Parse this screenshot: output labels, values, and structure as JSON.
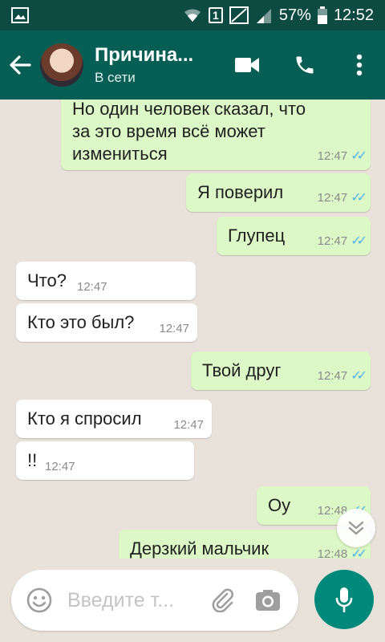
{
  "status_bar": {
    "sim_slot": "1",
    "battery": "57%",
    "time": "12:52"
  },
  "header": {
    "title": "Причина...",
    "subtitle": "В сети"
  },
  "messages": [
    {
      "type": "out",
      "text": "Но один человек сказал, что\nза это время всё может\nизмениться",
      "time": "12:47",
      "read": true
    },
    {
      "type": "out",
      "text": "Я поверил",
      "time": "12:47",
      "read": true
    },
    {
      "type": "out",
      "text": "Глупец",
      "time": "12:47",
      "read": true
    },
    {
      "type": "in",
      "text": "Что?",
      "time": "12:47"
    },
    {
      "type": "in",
      "text": "Кто это был?",
      "time": "12:47"
    },
    {
      "type": "out",
      "text": "Твой друг",
      "time": "12:47",
      "read": true
    },
    {
      "type": "in",
      "text": "Кто я спросил",
      "time": "12:47"
    },
    {
      "type": "in",
      "text": "!!",
      "time": "12:47"
    },
    {
      "type": "out",
      "text": "Оу",
      "time": "12:48",
      "read": true
    },
    {
      "type": "out",
      "text": "Дерзкий мальчик",
      "time": "12:48",
      "read": true
    }
  ],
  "composer": {
    "placeholder": "Введите т..."
  },
  "icons": {
    "back": "arrow-left-icon",
    "video": "video-call-icon",
    "call": "phone-icon",
    "menu": "more-vert-icon",
    "emoji": "emoji-icon",
    "attach": "attachment-icon",
    "camera": "camera-icon",
    "mic": "mic-icon",
    "scroll": "chevron-down-icon"
  },
  "colors": {
    "header": "#075e54",
    "status_bar": "#0c4a42",
    "outgoing": "#dcf8c6",
    "incoming": "#ffffff",
    "read_tick": "#4fb6ec",
    "mic_button": "#00897b"
  }
}
